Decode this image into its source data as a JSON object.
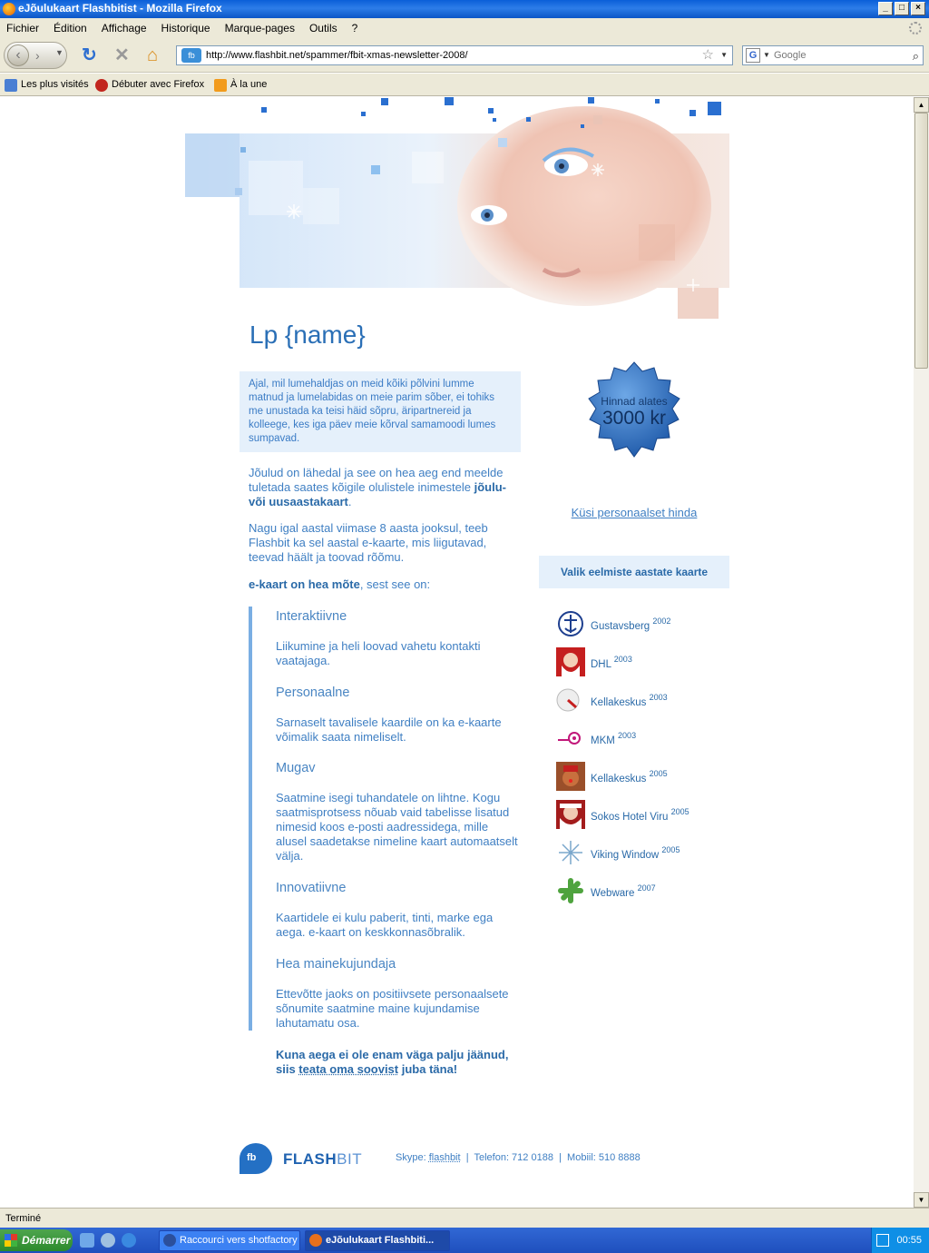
{
  "window": {
    "title": "eJõulukaart Flashbitist - Mozilla Firefox"
  },
  "menu": [
    "Fichier",
    "Édition",
    "Affichage",
    "Historique",
    "Marque-pages",
    "Outils",
    "?"
  ],
  "nav": {
    "url": "http://www.flashbit.net/spammer/fbit-xmas-newsletter-2008/",
    "search_placeholder": "Google"
  },
  "bookmarks": [
    "Les plus visités",
    "Débuter avec Firefox",
    "À la une"
  ],
  "page": {
    "greeting": "Lp {name}",
    "intro": "Ajal, mil lumehaldjas on meid kõiki põlvini lumme matnud ja lumelabidas on meie parim sõber, ei tohiks me unustada ka teisi häid sõpru, äripartnereid ja kolleege, kes iga päev meie kõrval samamoodi lumes sumpavad.",
    "p1_start": "Jõulud on lähedal ja see on hea aeg end meelde tuletada saates kõigile olulistele inimestele ",
    "p1_bold": "jõulu- või uusaastakaart",
    "p1_end": ".",
    "p2": "Nagu igal aastal viimase 8 aasta jooksul, teeb Flashbit ka sel aastal e-kaarte, mis liigutavad, teevad häält ja toovad rõõmu.",
    "p3_bold": "e-kaart on hea mõte",
    "p3_end": ", sest see on:",
    "features": [
      {
        "title": "Interaktiivne",
        "text": "Liikumine ja heli loovad vahetu kontakti vaatajaga."
      },
      {
        "title": "Personaalne",
        "text": "Sarnaselt tavalisele kaardile on ka e-kaarte võimalik saata nimeliselt."
      },
      {
        "title": "Mugav",
        "text": "Saatmine isegi tuhandatele on lihtne. Kogu saatmisprotsess nõuab vaid tabelisse lisatud nimesid koos e-posti aadressidega, mille alusel saadetakse nimeline kaart automaatselt välja."
      },
      {
        "title": "Innovatiivne",
        "text": "Kaartidele ei kulu paberit, tinti, marke ega aega. e-kaart on keskkonnasõbralik."
      },
      {
        "title": "Hea mainekujundaja",
        "text": "Ettevõtte jaoks on positiivsete personaalsete sõnumite saatmine maine kujundamise lahutamatu osa."
      }
    ],
    "cta_start": "Kuna aega ei ole enam väga palju jäänud, siis ",
    "cta_link": "teata oma soovist",
    "cta_end": " juba täna!",
    "badge_line1": "Hinnad alates",
    "badge_line2": "3000 kr",
    "ask_price": "Küsi personaalset hinda",
    "cards_header": "Valik eelmiste aastate kaarte",
    "cards": [
      {
        "name": "Gustavsberg",
        "year": "2002"
      },
      {
        "name": "DHL",
        "year": "2003"
      },
      {
        "name": "Kellakeskus",
        "year": "2003"
      },
      {
        "name": "MKM",
        "year": "2003"
      },
      {
        "name": "Kellakeskus",
        "year": "2005"
      },
      {
        "name": "Sokos Hotel Viru",
        "year": "2005"
      },
      {
        "name": "Viking Window",
        "year": "2005"
      },
      {
        "name": "Webware",
        "year": "2007"
      }
    ],
    "logo_fb": "fb",
    "logo_flash": "FLASH",
    "logo_bit": "BIT",
    "footer": {
      "skype_label": "Skype:",
      "skype": "flashbit",
      "phone": "Telefon: 712 0188",
      "mobile": "Mobiil: 510 8888",
      "sep": "|"
    }
  },
  "status": "Terminé",
  "taskbar": {
    "start": "Démarrer",
    "tasks": [
      "Raccourci vers shotfactory",
      "eJõulukaart Flashbiti..."
    ],
    "clock": "00:55"
  }
}
